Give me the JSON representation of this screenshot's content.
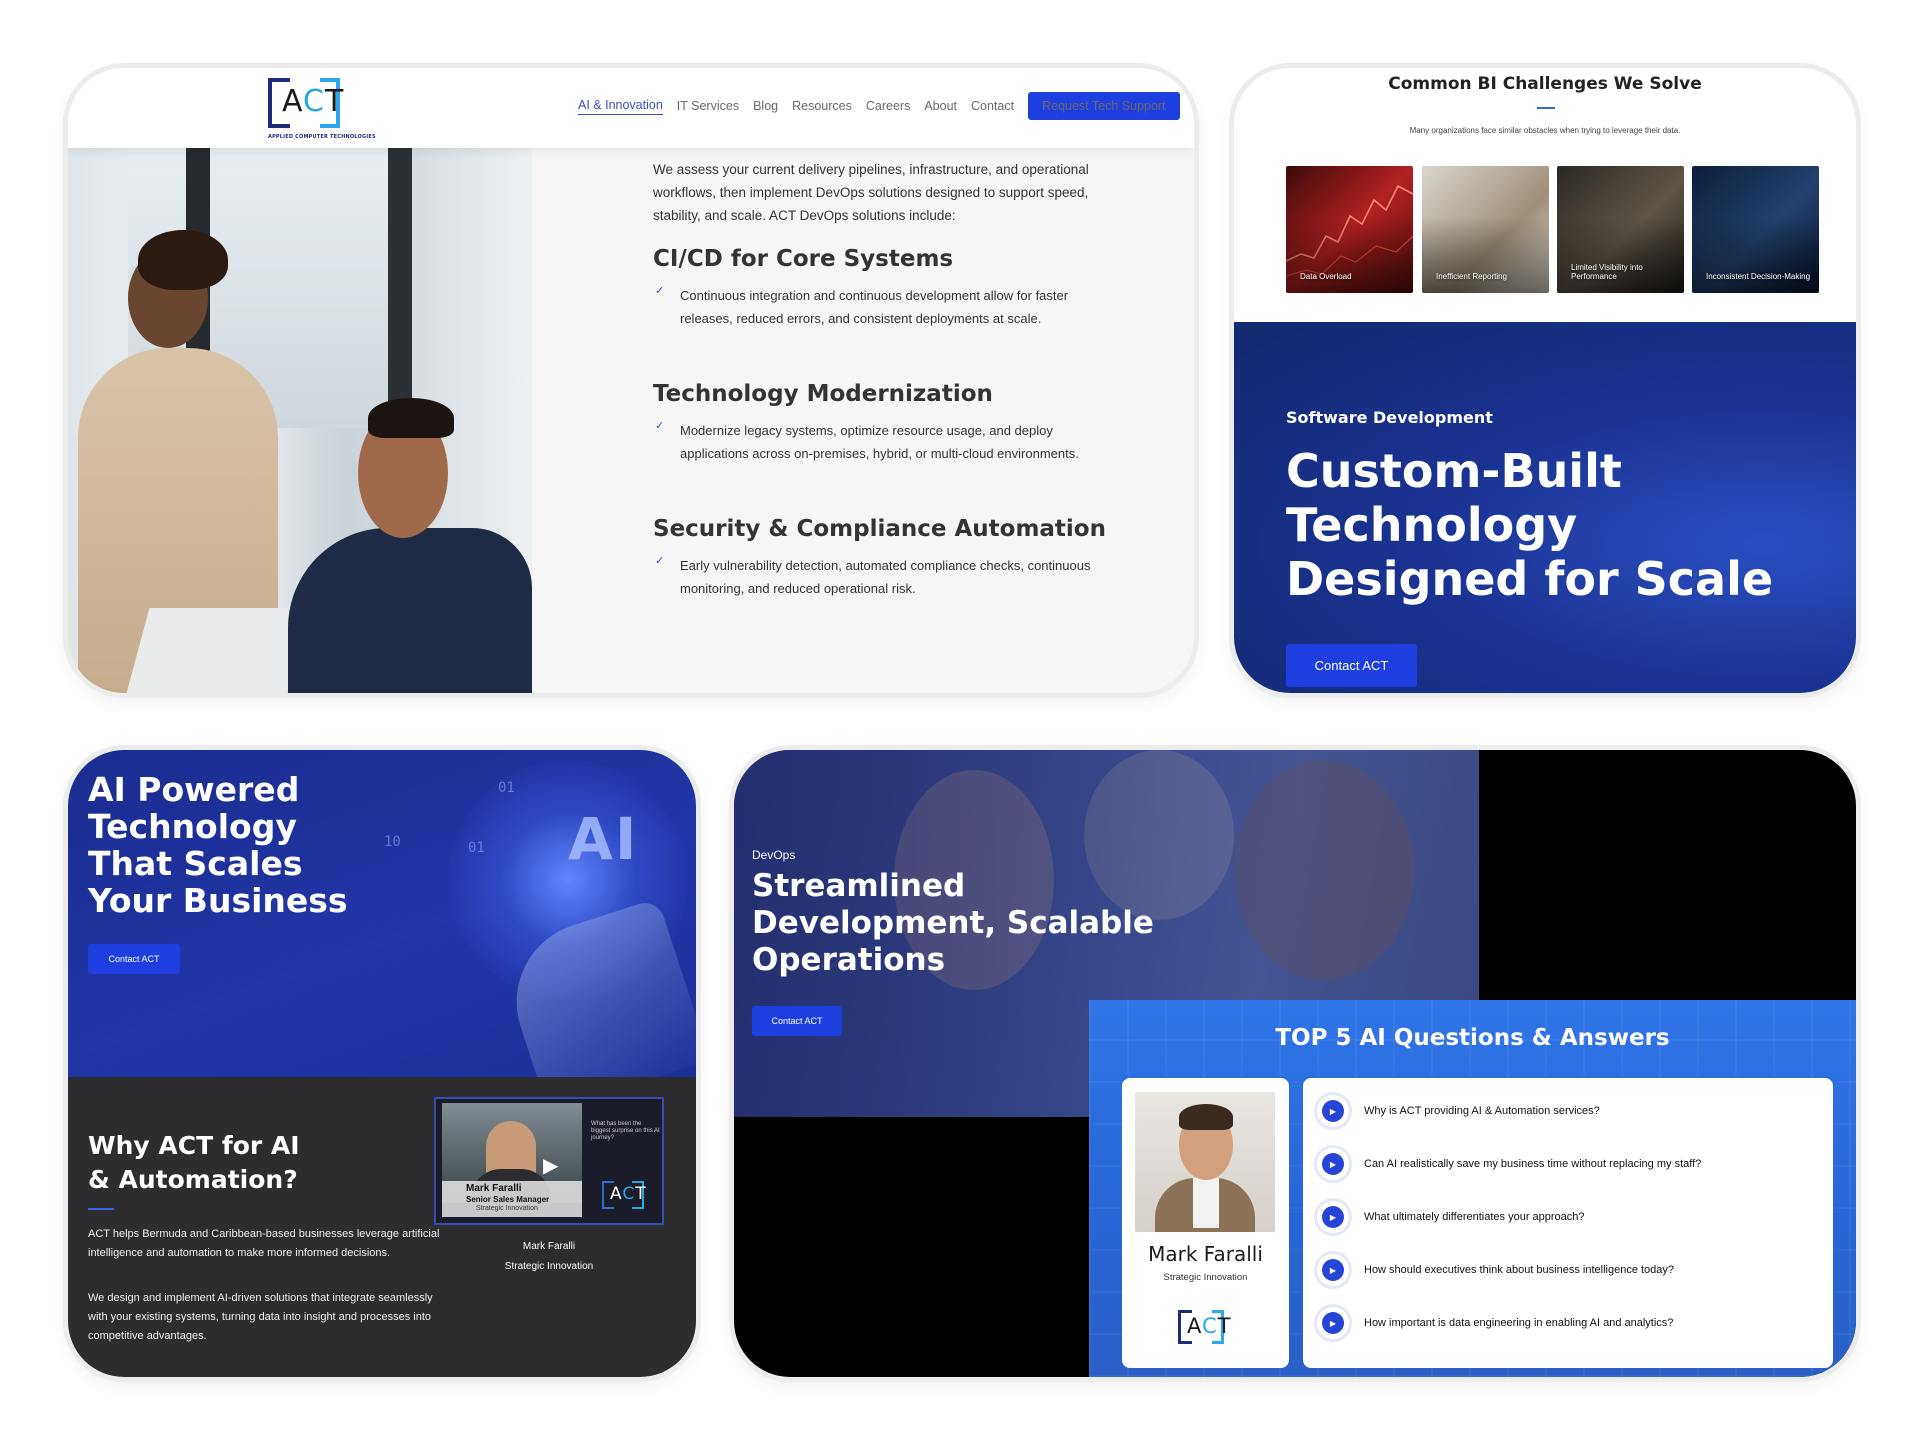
{
  "card1": {
    "logo": {
      "word": "ACT",
      "tagline": "APPLIED COMPUTER TECHNOLOGIES"
    },
    "nav": [
      "AI & Innovation",
      "IT Services",
      "Blog",
      "Resources",
      "Careers",
      "About",
      "Contact"
    ],
    "nav_active": "AI & Innovation",
    "cta": "Request Tech Support",
    "intro": "We assess your current delivery pipelines, infrastructure, and operational workflows, then implement DevOps solutions designed to support speed, stability, and scale. ACT DevOps solutions include:",
    "sections": [
      {
        "title": "CI/CD for Core Systems",
        "body": "Continuous integration and continuous development allow for faster releases, reduced errors, and consistent deployments at scale."
      },
      {
        "title": "Technology Modernization",
        "body": "Modernize legacy systems, optimize resource usage, and deploy applications across on-premises, hybrid, or multi-cloud environments."
      },
      {
        "title": "Security & Compliance Automation",
        "body": "Early vulnerability detection, automated compliance checks, continuous monitoring, and reduced operational risk."
      }
    ],
    "check_icon": "checkmark-icon"
  },
  "card2": {
    "title": "Common BI Challenges We Solve",
    "subtitle": "Many organizations face similar obstacles when trying to leverage their data.",
    "tiles": [
      "Data Overload",
      "Inefficient Reporting",
      "Limited Visibility into Performance",
      "Inconsistent Decision-Making"
    ],
    "hero": {
      "eyebrow": "Software Development",
      "headline": "Custom-Built Technology Designed for Scale",
      "button": "Contact ACT"
    }
  },
  "card3": {
    "hero": {
      "headline": "AI Powered Technology That Scales Your Business",
      "art_text": "AI",
      "bits": [
        "01",
        "01",
        "10"
      ],
      "button": "Contact ACT"
    },
    "why": {
      "headline": "Why ACT for AI & Automation?",
      "p1": "ACT helps Bermuda and Caribbean-based businesses leverage artificial intelligence and automation to make more informed decisions.",
      "p2": "We design and implement AI-driven solutions that integrate seamlessly with your existing systems, turning data into insight and processes into competitive advantages."
    },
    "video": {
      "side_text": "What has been the biggest surprise on this AI journey?",
      "lower_name": "Mark Faralli",
      "lower_role": "Senior Sales Manager",
      "lower_sub": "Strategic Innovation",
      "logo_word": "ACT",
      "caption_name": "Mark Faralli",
      "caption_role": "Strategic Innovation"
    }
  },
  "card4": {
    "hero": {
      "eyebrow": "DevOps",
      "headline": "Streamlined Development, Scalable Operations",
      "button": "Contact ACT"
    },
    "faq": {
      "title": "TOP 5 AI Questions & Answers",
      "profile_name": "Mark Faralli",
      "profile_role": "Strategic Innovation",
      "logo_word": "ACT",
      "questions": [
        "Why is ACT providing AI & Automation services?",
        "Can AI realistically save my business time without replacing my staff?",
        "What ultimately differentiates your approach?",
        "How should executives think about business intelligence today?",
        "How important is data engineering in enabling AI and analytics?"
      ]
    }
  }
}
